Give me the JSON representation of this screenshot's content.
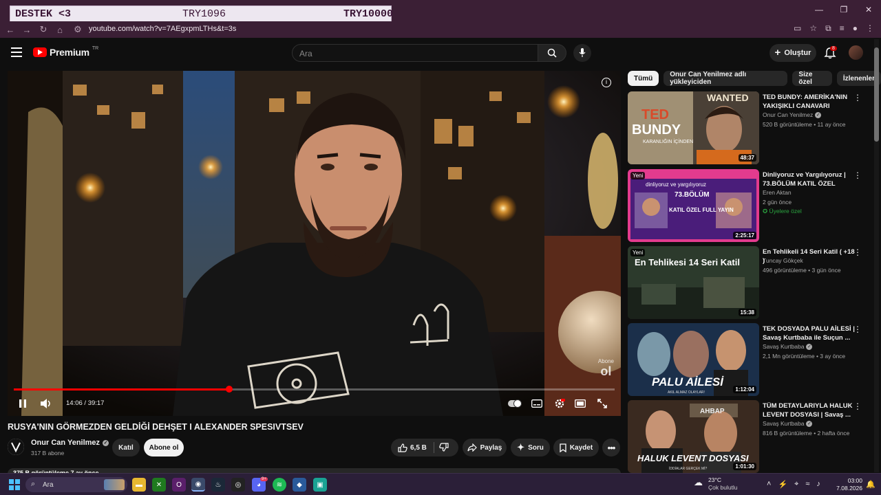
{
  "donation_overlay": {
    "label": "DESTEK <3",
    "amount_a": "TRY1096",
    "amount_b": "TRY10000"
  },
  "browser": {
    "url": "youtube.com/watch?v=7AEgxpmLTHs&t=3s"
  },
  "header": {
    "brand": "Premium",
    "region": "TR",
    "search_placeholder": "Ara",
    "create_label": "Oluştur",
    "notif_count": "8"
  },
  "player": {
    "time": "14:06 / 39:17",
    "progress_fraction": 0.359,
    "watermark_top": "Abone",
    "watermark_bottom": "ol"
  },
  "video": {
    "title": "RUSYA'NIN GÖRMEZDEN GELDİĞİ DEHŞET I ALEXANDER SPESIVTSEV",
    "channel": "Onur Can Yenilmez",
    "subscribers": "317 B abone",
    "join_label": "Katıl",
    "subscribe_label": "Abone ol",
    "likes": "6,5 B",
    "share_label": "Paylaş",
    "ask_label": "Soru",
    "save_label": "Kaydet",
    "description_peek": "375 B görüntüleme  7 ay önce"
  },
  "chips": [
    "Tümü",
    "Onur Can Yenilmez adlı yükleyiciden",
    "Size özel",
    "İzlenenler"
  ],
  "recommendations": [
    {
      "title": "TED BUNDY: AMERİKA'NIN YAKIŞIKLI CANAVARI",
      "channel": "Onur Can Yenilmez",
      "verified": true,
      "meta": "520 B görüntüleme • 11 ay önce",
      "duration": "48:37",
      "new": "",
      "members": ""
    },
    {
      "title": "Dinliyoruz ve Yargılıyoruz | 73.BÖLÜM KATIL ÖZEL",
      "channel": "Eren Aktan",
      "verified": false,
      "meta": "2 gün önce",
      "duration": "2:25:17",
      "new": "Yeni",
      "members": "Üyelere özel"
    },
    {
      "title": "En Tehlikeli 14 Seri Katil ( +18 )",
      "channel": "Tuncay Gökçek",
      "verified": false,
      "meta": "496 görüntüleme • 3 gün önce",
      "duration": "15:38",
      "new": "Yeni",
      "members": ""
    },
    {
      "title": "TEK DOSYADA PALU AİLESİ | Savaş Kurtbaba ile Suçun ...",
      "channel": "Savaş Kurtbaba",
      "verified": true,
      "meta": "2,1 Mn görüntüleme • 3 ay önce",
      "duration": "1:12:04",
      "new": "",
      "members": ""
    },
    {
      "title": "TÜM DETAYLARIYLA HALUK LEVENT DOSYASI | Savaş ...",
      "channel": "Savaş Kurtbaba",
      "verified": true,
      "meta": "816 B görüntüleme • 2 hafta önce",
      "duration": "1:01:30",
      "new": "",
      "members": ""
    }
  ],
  "thumb_text": {
    "bundy_top": "TED",
    "bundy_big": "BUNDY",
    "bundy_sub": "KARANLIĞIN İÇİNDEN",
    "wanted": "WANTED",
    "dinli_top": "dinliyoruz ve yargılıyoruz",
    "dinli_ep": "73.BÖLÜM",
    "dinli_main": "KATIL ÖZEL FULL YAYIN",
    "tehlike": "En Tehlikesi 14 Seri Katil",
    "palu": "PALU AİLESİ",
    "palu_sub": "AKIL ALMAZ OLAYLAR!",
    "haluk": "HALUK LEVENT DOSYASI",
    "haluk_sub": "İDDİALAR GERÇEK Mİ?",
    "ahbap": "AHBAP"
  },
  "taskbar": {
    "search": "Ara",
    "temp": "23°C",
    "weather": "Çok bulutlu",
    "time": "03:00",
    "date": "7.08.2026",
    "discord_badge": "9+"
  }
}
